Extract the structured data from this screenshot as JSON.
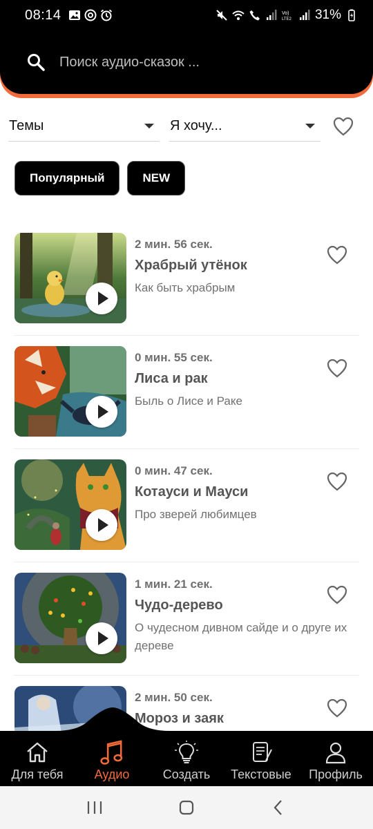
{
  "status_bar": {
    "time": "08:14",
    "battery_percent": "31%",
    "icons": [
      "image-icon",
      "at-icon",
      "alarm-icon",
      "mute-icon",
      "wifi-icon",
      "call-icon",
      "signal-icon",
      "volte-icon",
      "signal-icon",
      "battery-charging-icon"
    ]
  },
  "search": {
    "placeholder": "Поиск аудио-сказок ..."
  },
  "filters": {
    "themes_label": "Темы",
    "want_label": "Я хочу..."
  },
  "chips": {
    "popular": "Популярный",
    "new": "NEW"
  },
  "stories": [
    {
      "duration": "2 мин. 56 сек.",
      "title": "Храбрый утёнок",
      "subtitle": "Как быть храбрым"
    },
    {
      "duration": "0 мин. 55 сек.",
      "title": "Лиса и рак",
      "subtitle": "Быль о Лисе и Раке"
    },
    {
      "duration": "0 мин. 47 сек.",
      "title": "Котауси и Мауси",
      "subtitle": "Про зверей любимцев"
    },
    {
      "duration": "1 мин. 21 сек.",
      "title": "Чудо-дерево",
      "subtitle": "О чудесном дивном сайде и о друге их дереве"
    },
    {
      "duration": "2 мин. 50 сек.",
      "title": "Мороз и заяк",
      "subtitle": ""
    }
  ],
  "nav": {
    "for_you": "Для тебя",
    "audio": "Аудио",
    "create": "Создать",
    "text": "Текстовые",
    "profile": "Профиль"
  },
  "colors": {
    "accent": "#f26b3a",
    "header_bg": "#000000",
    "text_muted": "#6f6f6f"
  }
}
